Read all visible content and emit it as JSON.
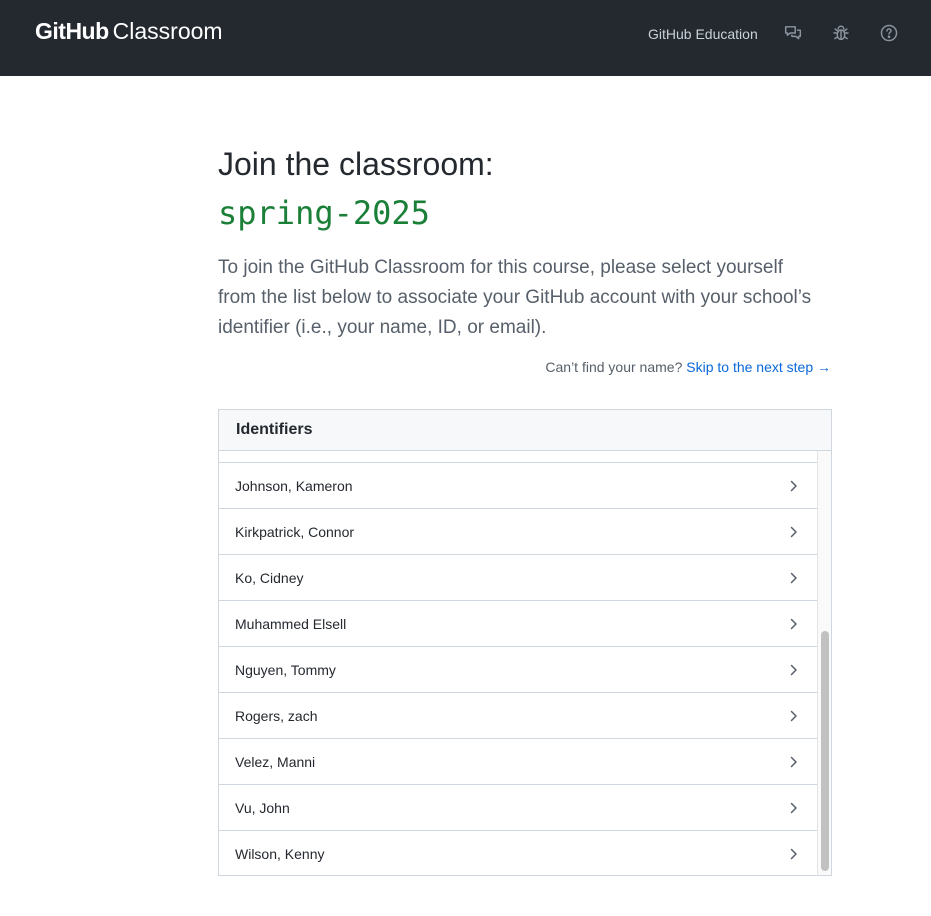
{
  "header": {
    "logo_bold": "GitHub",
    "logo_light": "Classroom",
    "nav_link": "GitHub Education",
    "icons": [
      "comment-discussion-icon",
      "bug-icon",
      "question-icon"
    ]
  },
  "main": {
    "title": "Join the classroom:",
    "classroom_name": "spring-2025",
    "description": "To join the GitHub Classroom for this course, please select yourself from the list below to associate your GitHub account with your school’s identifier (i.e., your name, ID, or email).",
    "skip_prompt": "Can’t find your name?",
    "skip_link": "Skip to the next step →"
  },
  "identifiers": {
    "header": "Identifiers",
    "items": [
      "Johnson, Kameron",
      "Kirkpatrick, Connor",
      "Ko, Cidney",
      "Muhammed Elsell",
      "Nguyen, Tommy",
      "Rogers, zach",
      "Velez, Manni",
      "Vu, John",
      "Wilson, Kenny"
    ]
  },
  "colors": {
    "header_bg": "#24292f",
    "classroom_green": "#1a7f37",
    "link_blue": "#0969da"
  }
}
